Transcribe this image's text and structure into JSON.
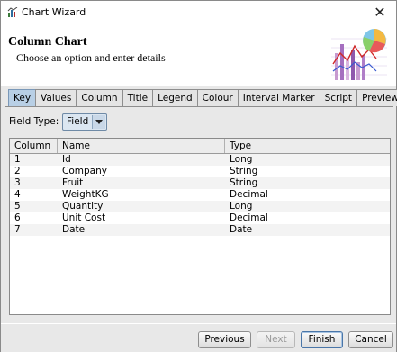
{
  "window": {
    "title": "Chart Wizard",
    "close_glyph": "✕"
  },
  "header": {
    "title": "Column Chart",
    "subtitle": "Choose an option and enter details",
    "art_icon": "chart-illustration"
  },
  "tabs": [
    {
      "label": "Key",
      "active": true
    },
    {
      "label": "Values"
    },
    {
      "label": "Column"
    },
    {
      "label": "Title"
    },
    {
      "label": "Legend"
    },
    {
      "label": "Colour"
    },
    {
      "label": "Interval Marker"
    },
    {
      "label": "Script"
    },
    {
      "label": "Preview"
    }
  ],
  "field_type": {
    "label": "Field Type:",
    "value": "Field"
  },
  "table": {
    "columns": [
      "Column",
      "Name",
      "Type"
    ],
    "rows": [
      [
        "1",
        "Id",
        "Long"
      ],
      [
        "2",
        "Company",
        "String"
      ],
      [
        "3",
        "Fruit",
        "String"
      ],
      [
        "4",
        "WeightKG",
        "Decimal"
      ],
      [
        "5",
        "Quantity",
        "Long"
      ],
      [
        "6",
        "Unit Cost",
        "Decimal"
      ],
      [
        "7",
        "Date",
        "Date"
      ]
    ]
  },
  "buttons": {
    "previous": "Previous",
    "next": "Next",
    "finish": "Finish",
    "cancel": "Cancel"
  }
}
